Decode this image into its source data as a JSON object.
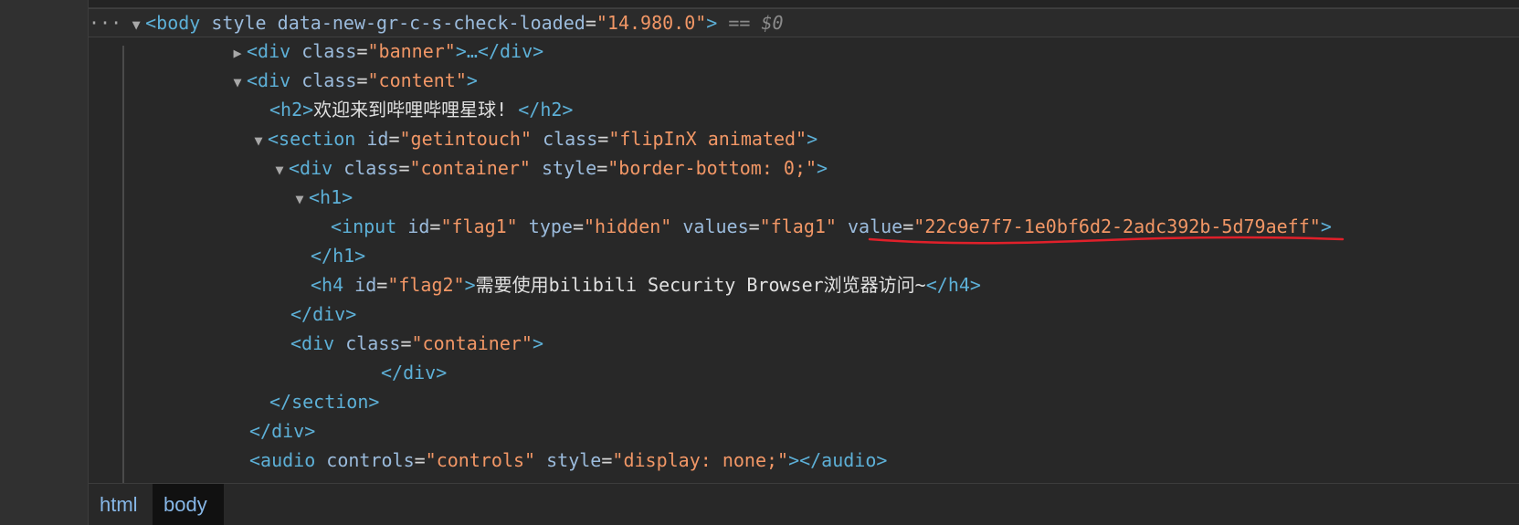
{
  "dom": {
    "selected_marker": "== $0",
    "collapsed_dots": "···",
    "nodes": {
      "body_open": {
        "tag": "<body",
        "a1": "style",
        "a2": "data-new-gr-c-s-check-loaded",
        "v2": "\"14.980.0\"",
        "close": ">"
      },
      "banner": {
        "tag": "<div",
        "attr": "class",
        "val": "\"banner\"",
        "ellipsis": ">…",
        "close": "</div>"
      },
      "content": {
        "tag": "<div",
        "attr": "class",
        "val": "\"content\"",
        "close": ">"
      },
      "h2": {
        "open": "<h2>",
        "text": "欢迎来到哔哩哔哩星球! ",
        "close": "</h2>"
      },
      "section": {
        "tag": "<section",
        "a1": "id",
        "v1": "\"getintouch\"",
        "a2": "class",
        "v2": "\"flipInX animated\"",
        "close": ">"
      },
      "container1": {
        "tag": "<div",
        "a1": "class",
        "v1": "\"container\"",
        "a2": "style",
        "v2": "\"border-bottom: 0;\"",
        "close": ">"
      },
      "h1_open": "<h1>",
      "input": {
        "tag": "<input",
        "a1": "id",
        "v1": "\"flag1\"",
        "a2": "type",
        "v2": "\"hidden\"",
        "a3": "values",
        "v3": "\"flag1\"",
        "a4": "value",
        "v4": "\"22c9e7f7-1e0bf6d2-2adc392b-5d79aeff\"",
        "close": ">"
      },
      "h1_close": "</h1>",
      "h4": {
        "tag": "<h4",
        "attr": "id",
        "val": "\"flag2\"",
        "gt": ">",
        "text": "需要使用bilibili Security Browser浏览器访问~",
        "close": "</h4>"
      },
      "div_close_1": "</div>",
      "container2": {
        "tag": "<div",
        "attr": "class",
        "val": "\"container\"",
        "close": ">"
      },
      "div_close_2": "</div>",
      "section_close": "</section>",
      "div_close_3": "</div>",
      "audio": {
        "tag": "<audio",
        "a1": "controls",
        "v1": "\"controls\"",
        "a2": "style",
        "v2": "\"display: none;\"",
        "close": "></audio>"
      }
    }
  },
  "breadcrumbs": [
    "html",
    "body"
  ],
  "colors": {
    "tag": "#5db0d7",
    "attr": "#9bbbdc",
    "value": "#f29766",
    "underline": "#e0202a"
  }
}
